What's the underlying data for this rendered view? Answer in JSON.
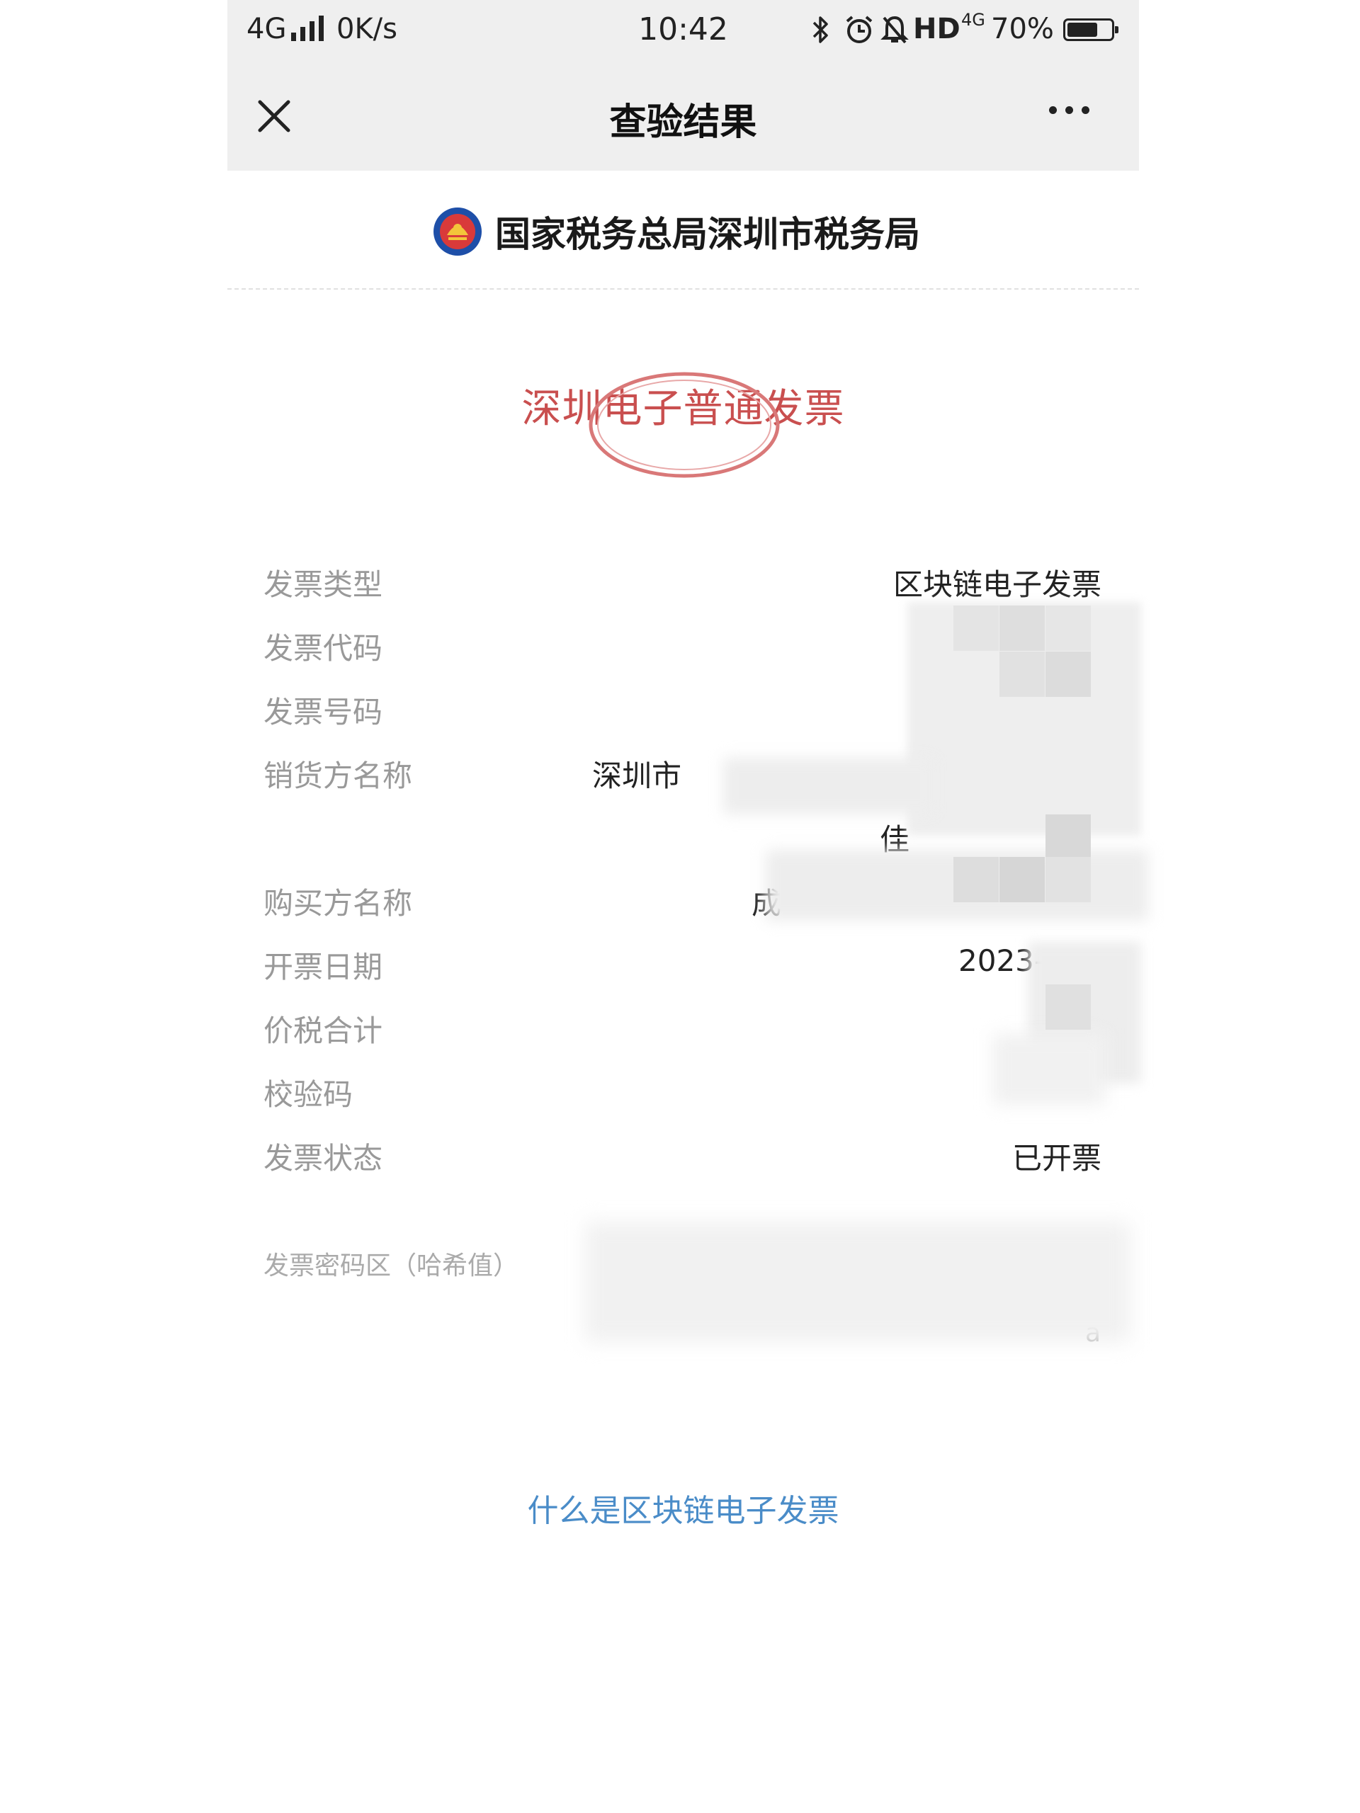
{
  "status_bar": {
    "network": "4G",
    "speed": "0K/s",
    "time": "10:42",
    "hd": "HD",
    "net_small": "4G",
    "battery": "70%",
    "battery_level": 0.7
  },
  "nav": {
    "title": "查验结果",
    "close_icon": "close-icon",
    "more_icon": "more-icon"
  },
  "issuer": {
    "name": "国家税务总局深圳市税务局",
    "emblem_icon": "tax-emblem-icon"
  },
  "invoice_title": "深圳电子普通发票",
  "fields": [
    {
      "label": "发票类型",
      "value": "区块链电子发票"
    },
    {
      "label": "发票代码",
      "value": ""
    },
    {
      "label": "发票号码",
      "value": ""
    },
    {
      "label": "销货方名称",
      "value": "深圳市",
      "value2": "佳"
    },
    {
      "label": "购买方名称",
      "value": "成"
    },
    {
      "label": "开票日期",
      "value": "2023-"
    },
    {
      "label": "价税合计",
      "value": ""
    },
    {
      "label": "校验码",
      "value": ""
    },
    {
      "label": "发票状态",
      "value": "已开票"
    }
  ],
  "hash": {
    "label": "发票密码区（哈希值）",
    "tail": "a"
  },
  "help_link": "什么是区块链电子发票",
  "colors": {
    "bar_bg": "#efefef",
    "stamp_red": "#c94f4f",
    "link_blue": "#4a8cc8",
    "label_gray": "#999999"
  }
}
